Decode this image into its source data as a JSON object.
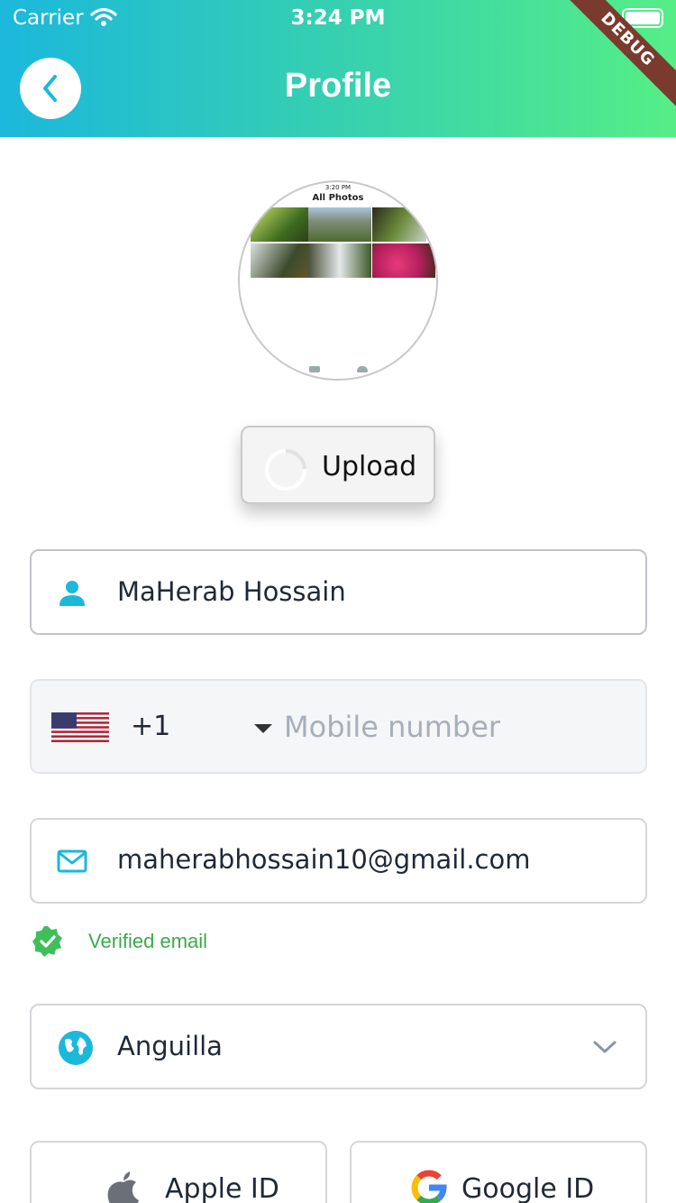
{
  "status_bar": {
    "carrier": "Carrier",
    "time": "3:24 PM"
  },
  "header": {
    "title": "Profile",
    "debug_badge": "DEBUG"
  },
  "avatar_preview": {
    "time": "3:20 PM",
    "title": "All Photos"
  },
  "upload": {
    "label": "Upload"
  },
  "name_field": {
    "value": "MaHerab Hossain",
    "icon": "person-icon"
  },
  "phone_field": {
    "dial_code": "+1",
    "country_flag": "us-flag-icon",
    "placeholder": "Mobile number",
    "value": ""
  },
  "email_field": {
    "value": "maherabhossain10@gmail.com",
    "icon": "mail-icon"
  },
  "verification": {
    "label": "Verified email",
    "color": "#3aaa4a"
  },
  "country_field": {
    "value": "Anguilla",
    "icon": "globe-icon"
  },
  "social": {
    "apple_label": "Apple ID",
    "google_label": "Google ID"
  },
  "colors": {
    "accent": "#1bb8dc",
    "gradient_end": "#55ee86",
    "debug_ribbon": "#7a3b2e"
  }
}
